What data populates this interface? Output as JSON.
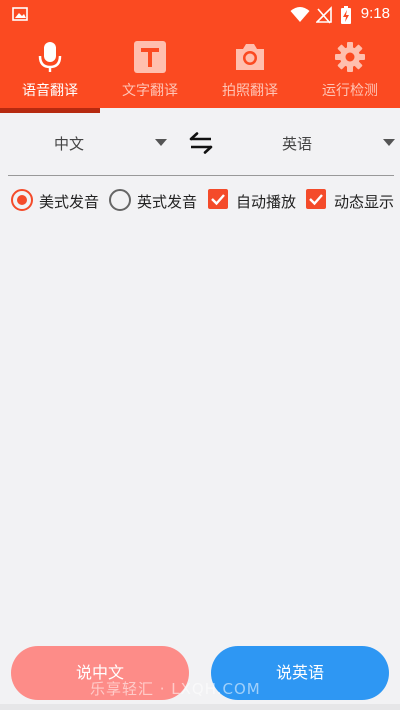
{
  "status_bar": {
    "time": "9:18"
  },
  "tabs": [
    {
      "label": "语音翻译",
      "icon": "microphone-icon",
      "active": true
    },
    {
      "label": "文字翻译",
      "icon": "text-t-icon",
      "active": false
    },
    {
      "label": "拍照翻译",
      "icon": "camera-icon",
      "active": false
    },
    {
      "label": "运行检测",
      "icon": "gear-icon",
      "active": false
    }
  ],
  "language": {
    "source": "中文",
    "target": "英语",
    "swap_icon": "swap-arrows-icon"
  },
  "options": {
    "american": {
      "label": "美式发音",
      "selected": true
    },
    "british": {
      "label": "英式发音",
      "selected": false
    },
    "autoplay": {
      "label": "自动播放",
      "checked": true
    },
    "dynamic": {
      "label": "动态显示",
      "checked": true
    }
  },
  "buttons": {
    "speak_chinese": "说中文",
    "speak_english": "说英语"
  },
  "watermark": "乐享轻汇 · LXQH.COM",
  "colors": {
    "primary": "#fb4a21",
    "accent_red": "#f44b2a",
    "button_pink": "#fd8c88",
    "button_blue": "#2e97f3"
  }
}
